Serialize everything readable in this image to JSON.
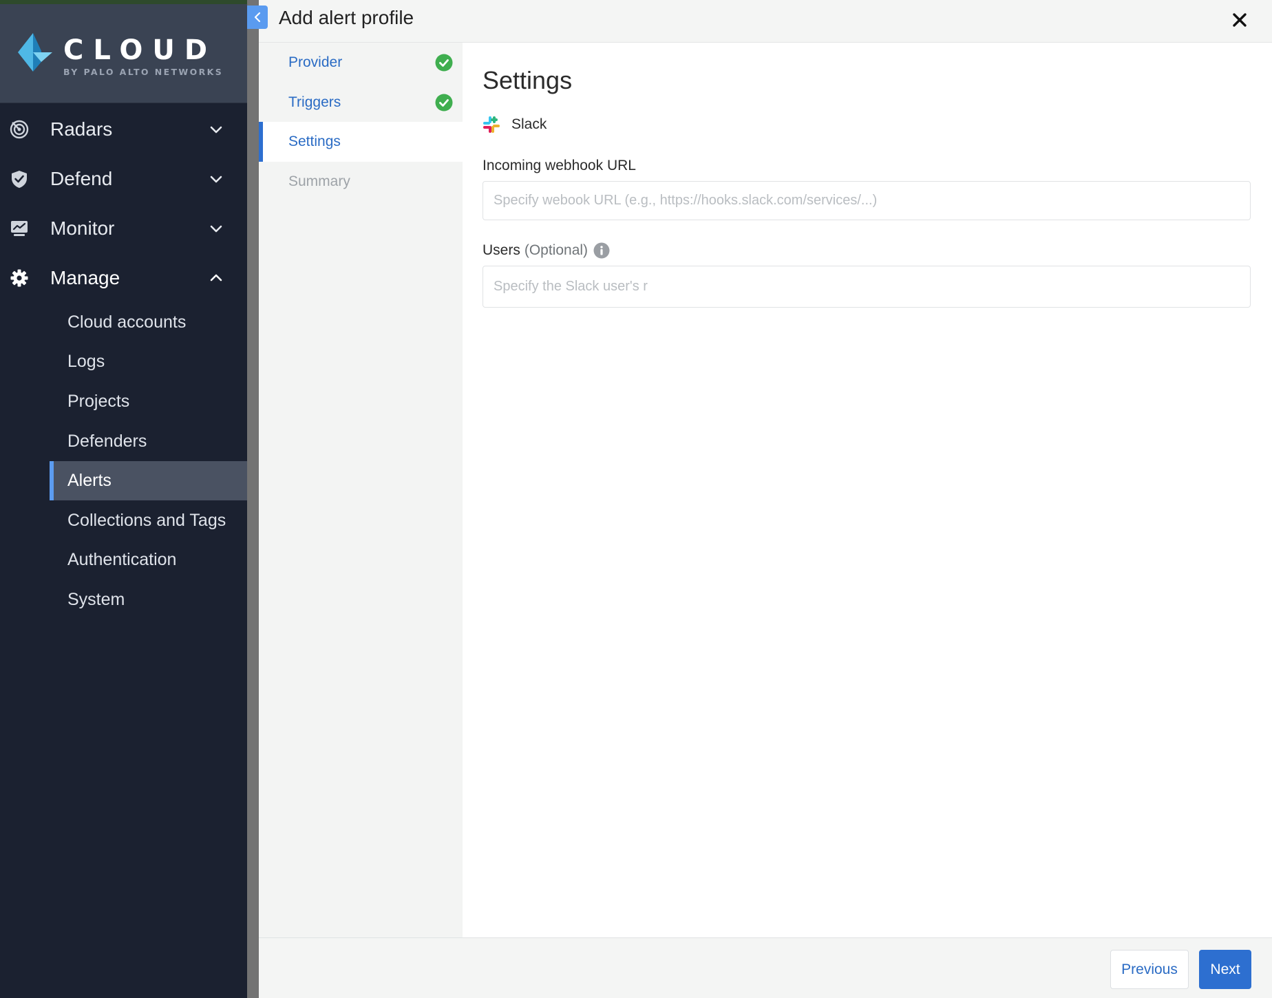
{
  "app": {
    "logo_word": "CLOUD",
    "logo_tagline": "BY PALO ALTO NETWORKS"
  },
  "sidebar": {
    "sections": [
      {
        "label": "Radars",
        "icon": "radar-icon",
        "expanded": false
      },
      {
        "label": "Defend",
        "icon": "shield-icon",
        "expanded": false
      },
      {
        "label": "Monitor",
        "icon": "monitor-icon",
        "expanded": false
      },
      {
        "label": "Manage",
        "icon": "gear-icon",
        "expanded": true
      }
    ],
    "manage_items": [
      {
        "label": "Cloud accounts"
      },
      {
        "label": "Logs"
      },
      {
        "label": "Projects"
      },
      {
        "label": "Defenders"
      },
      {
        "label": "Alerts",
        "active": true
      },
      {
        "label": "Collections and Tags"
      },
      {
        "label": "Authentication"
      },
      {
        "label": "System"
      }
    ]
  },
  "drawer": {
    "title": "Add alert profile",
    "steps": [
      {
        "label": "Provider",
        "status": "complete"
      },
      {
        "label": "Triggers",
        "status": "complete"
      },
      {
        "label": "Settings",
        "status": "active"
      },
      {
        "label": "Summary",
        "status": "pending"
      }
    ],
    "content": {
      "title": "Settings",
      "provider": "Slack",
      "webhook_label": "Incoming webhook URL",
      "webhook_value": "",
      "webhook_placeholder": "Specify webook URL (e.g., https://hooks.slack.com/services/...)",
      "users_label": "Users",
      "users_optional": "(Optional)",
      "users_value": "",
      "users_placeholder": "Specify the Slack user's r"
    },
    "footer": {
      "previous_label": "Previous",
      "next_label": "Next"
    }
  },
  "colors": {
    "sidebar_bg": "#1b2130",
    "accent_blue": "#2d6fd0",
    "active_bar": "#5c9cf0",
    "success_green": "#3fae4f"
  }
}
